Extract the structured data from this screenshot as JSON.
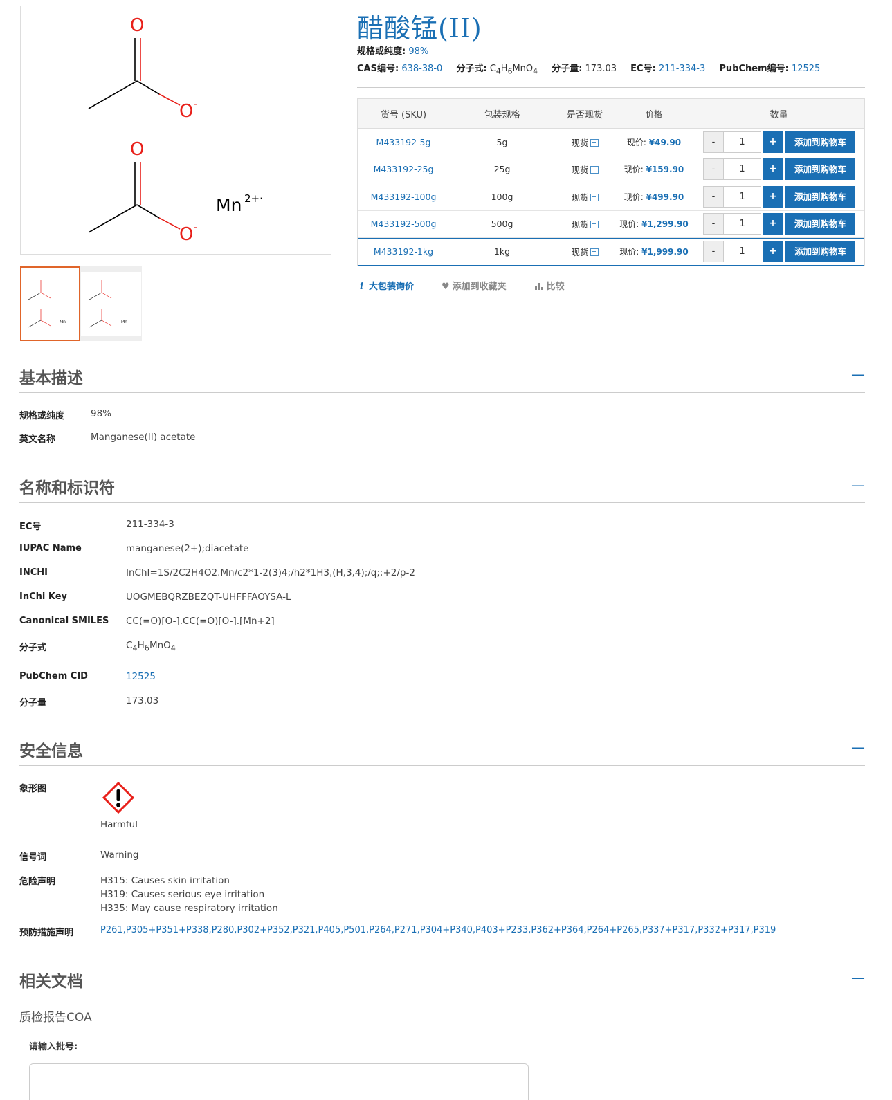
{
  "product": {
    "title": "醋酸锰(II)",
    "spec_label": "规格或纯度:",
    "spec_value": "98%",
    "cas_label": "CAS编号:",
    "cas_value": "638-38-0",
    "formula_label": "分子式:",
    "mw_label": "分子量:",
    "mw_value": "173.03",
    "ec_label": "EC号:",
    "ec_value": "211-334-3",
    "pubchem_label": "PubChem编号:",
    "pubchem_value": "12525"
  },
  "structure": {
    "o_top": "O",
    "o_minus_top": "O",
    "charge_minus": "-",
    "mn_label": "Mn",
    "mn_charge": "2+·"
  },
  "sku_table": {
    "headers": [
      "货号 (SKU)",
      "包装规格",
      "是否现货",
      "价格",
      "数量"
    ],
    "rows": [
      {
        "sku": "M433192-5g",
        "pack": "5g",
        "stock": "现货",
        "price_label": "现价:",
        "price": "¥49.90",
        "qty": "1"
      },
      {
        "sku": "M433192-25g",
        "pack": "25g",
        "stock": "现货",
        "price_label": "现价:",
        "price": "¥159.90",
        "qty": "1"
      },
      {
        "sku": "M433192-100g",
        "pack": "100g",
        "stock": "现货",
        "price_label": "现价:",
        "price": "¥499.90",
        "qty": "1"
      },
      {
        "sku": "M433192-500g",
        "pack": "500g",
        "stock": "现货",
        "price_label": "现价:",
        "price": "¥1,299.90",
        "qty": "1"
      },
      {
        "sku": "M433192-1kg",
        "pack": "1kg",
        "stock": "现货",
        "price_label": "现价:",
        "price": "¥1,999.90",
        "qty": "1"
      }
    ],
    "minus": "-",
    "plus": "+",
    "add_to_cart": "添加到购物车"
  },
  "actions": {
    "bulk": "大包装询价",
    "favorite": "添加到收藏夹",
    "compare": "比较"
  },
  "basic": {
    "title": "基本描述",
    "collapse": "—",
    "spec_label": "规格或纯度",
    "spec_value": "98%",
    "en_label": "英文名称",
    "en_value": "Manganese(II) acetate"
  },
  "identifiers": {
    "title": "名称和标识符",
    "collapse": "—",
    "ec_label": "EC号",
    "ec_value": "211-334-3",
    "iupac_label": "IUPAC Name",
    "iupac_value": "manganese(2+);diacetate",
    "inchi_label": "INCHI",
    "inchi_value": "InChI=1S/2C2H4O2.Mn/c2*1-2(3)4;/h2*1H3,(H,3,4);/q;;+2/p-2",
    "inchikey_label": "InChi Key",
    "inchikey_value": "UOGMEBQRZBEZQT-UHFFFAOYSA-L",
    "smiles_label": "Canonical SMILES",
    "smiles_value": "CC(=O)[O-].CC(=O)[O-].[Mn+2]",
    "formula_label": "分子式",
    "pubchem_label": "PubChem CID",
    "pubchem_value": "12525",
    "mw_label": "分子量",
    "mw_value": "173.03"
  },
  "safety": {
    "title": "安全信息",
    "collapse": "—",
    "pictogram_label": "象形图",
    "pictogram_name": "Harmful",
    "signal_label": "信号词",
    "signal_value": "Warning",
    "hazard_label": "危险声明",
    "hazards": [
      "H315: Causes skin irritation",
      "H319: Causes serious eye irritation",
      "H335: May cause respiratory irritation"
    ],
    "precaution_label": "预防措施声明",
    "precaution_value": "P261,P305+P351+P338,P280,P302+P352,P321,P405,P501,P264,P271,P304+P340,P403+P233,P362+P364,P264+P265,P337+P317,P332+P317,P319"
  },
  "documents": {
    "title": "相关文档",
    "collapse": "—",
    "coa_title": "质检报告COA",
    "batch_label": "请输入批号:"
  },
  "colors": {
    "accent": "#1a6fb4",
    "thumb_active_border": "#e0652a",
    "oxygen_red": "#e8201a"
  }
}
